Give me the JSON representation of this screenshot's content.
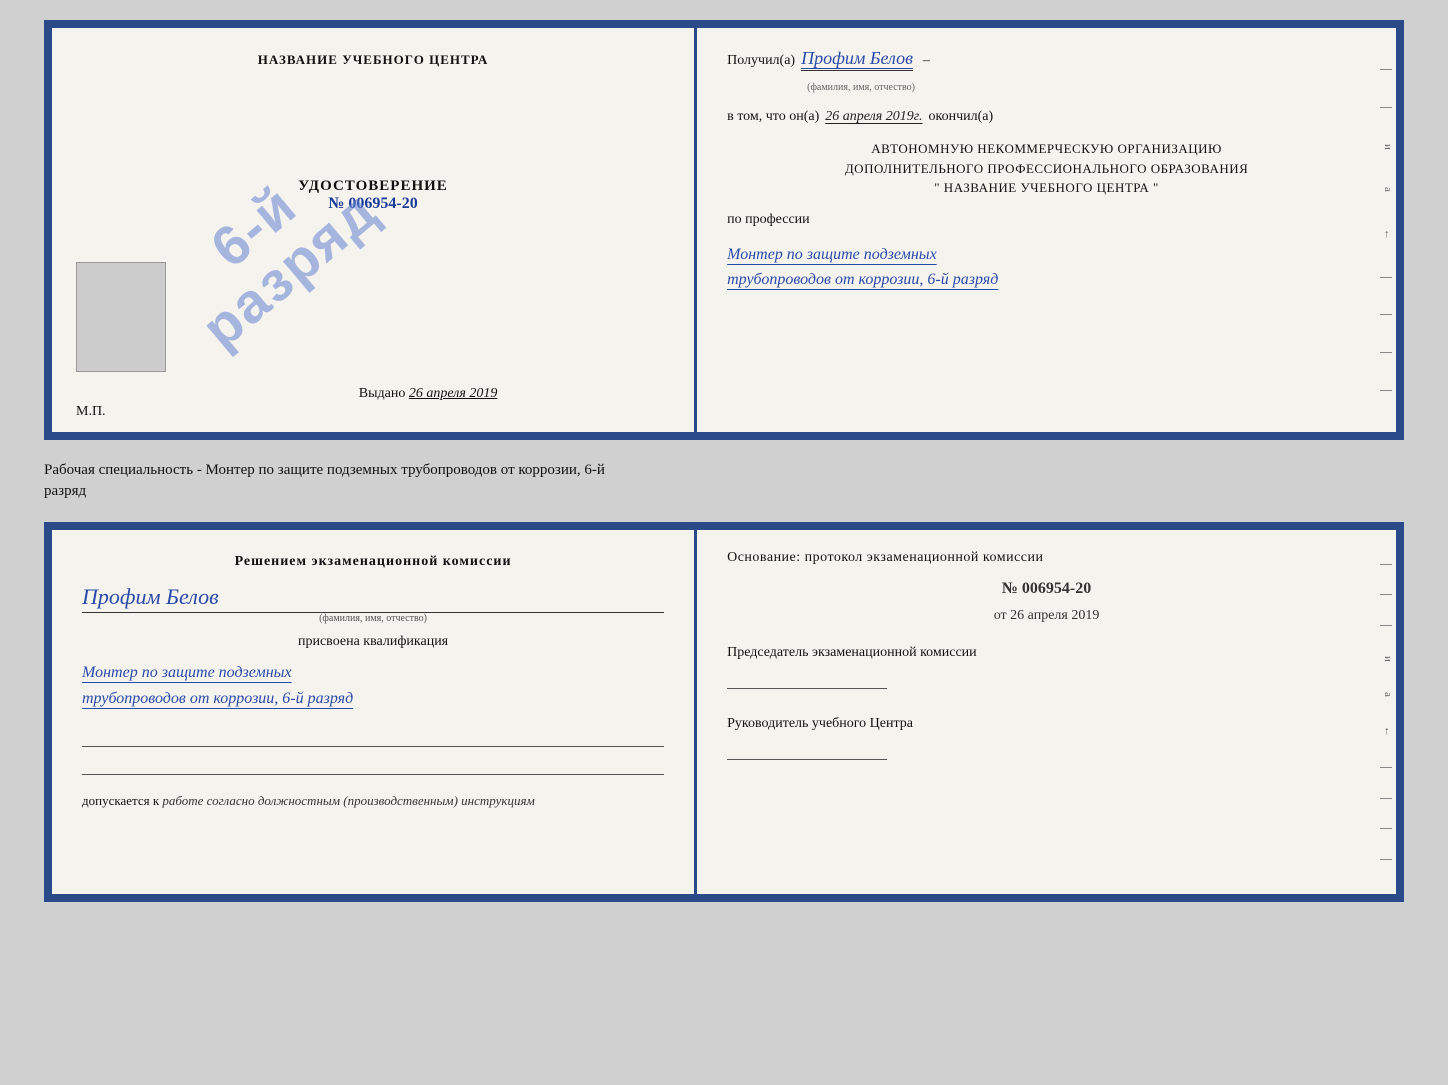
{
  "top_document": {
    "left": {
      "heading": "НАЗВАНИЕ УЧЕБНОГО ЦЕНТРА",
      "stamp_line1": "6-й",
      "stamp_line2": "разряд",
      "cert_title": "УДОСТОВЕРЕНИЕ",
      "cert_number": "№ 006954-20",
      "issued_label": "Выдано",
      "issued_date": "26 апреля 2019",
      "mp_label": "М.П."
    },
    "right": {
      "received_prefix": "Получил(а)",
      "received_name": "Профим Белов",
      "received_hint": "(фамилия, имя, отчество)",
      "in_that_prefix": "в том, что он(а)",
      "in_that_date": "26 апреля 2019г.",
      "finished_label": "окончил(а)",
      "org_line1": "АВТОНОМНУЮ НЕКОММЕРЧЕСКУЮ ОРГАНИЗАЦИЮ",
      "org_line2": "ДОПОЛНИТЕЛЬНОГО ПРОФЕССИОНАЛЬНОГО ОБРАЗОВАНИЯ",
      "org_line3": "\"   НАЗВАНИЕ УЧЕБНОГО ЦЕНТРА   \"",
      "profession_label": "по профессии",
      "profession_handwritten_1": "Монтер по защите подземных",
      "profession_handwritten_2": "трубопроводов от коррозии, 6-й разряд"
    }
  },
  "middle_text": {
    "line1": "Рабочая специальность - Монтер по защите подземных трубопроводов от коррозии, 6-й",
    "line2": "разряд"
  },
  "bottom_document": {
    "left": {
      "decision_heading": "Решением экзаменационной комиссии",
      "person_name": "Профим Белов",
      "person_hint": "(фамилия, имя, отчество)",
      "assigned_text": "присвоена квалификация",
      "qualification_1": "Монтер по защите подземных",
      "qualification_2": "трубопроводов от коррозии, 6-й разряд",
      "allowed_prefix": "допускается к",
      "allowed_handwritten": "работе согласно должностным (производственным) инструкциям"
    },
    "right": {
      "basis_heading": "Основание: протокол экзаменационной комиссии",
      "protocol_number": "№ 006954-20",
      "protocol_date_prefix": "от",
      "protocol_date": "26 апреля 2019",
      "chairman_title": "Председатель экзаменационной комиссии",
      "head_title": "Руководитель учебного Центра"
    }
  }
}
